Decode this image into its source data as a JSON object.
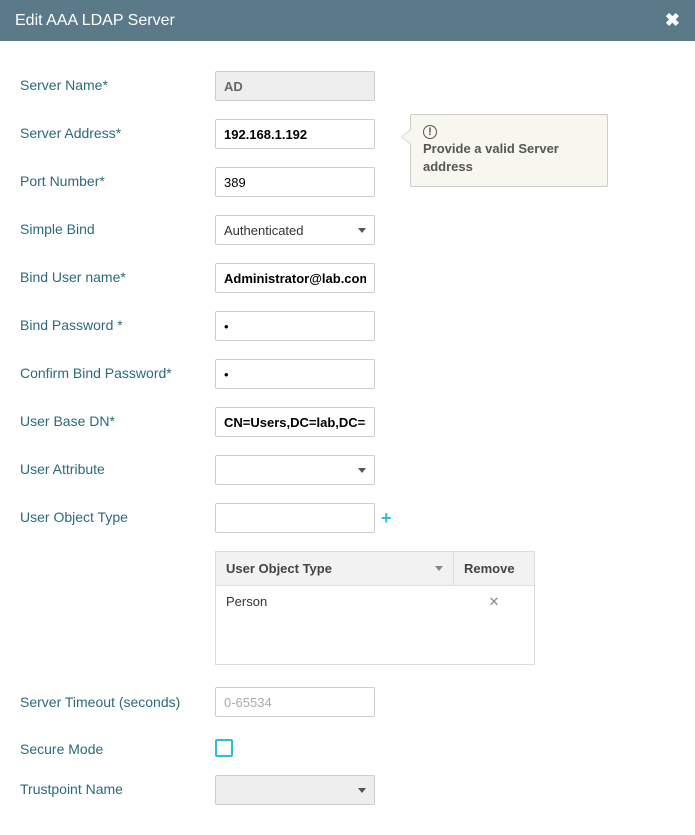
{
  "header": {
    "title": "Edit AAA LDAP Server"
  },
  "fields": {
    "serverName": {
      "label": "Server Name*",
      "value": "AD"
    },
    "serverAddress": {
      "label": "Server Address*",
      "value": "192.168.1.192"
    },
    "portNumber": {
      "label": "Port Number*",
      "value": "389"
    },
    "simpleBind": {
      "label": "Simple Bind",
      "value": "Authenticated"
    },
    "bindUser": {
      "label": "Bind User name*",
      "value": "Administrator@lab.com"
    },
    "bindPassword": {
      "label": "Bind Password *",
      "value": "•"
    },
    "confirmPassword": {
      "label": "Confirm Bind Password*",
      "value": "•"
    },
    "userBaseDN": {
      "label": "User Base DN*",
      "value": "CN=Users,DC=lab,DC=com"
    },
    "userAttribute": {
      "label": "User Attribute",
      "value": ""
    },
    "userObjectType": {
      "label": "User Object Type",
      "value": ""
    },
    "serverTimeout": {
      "label": "Server Timeout (seconds)",
      "placeholder": "0-65534",
      "value": ""
    },
    "secureMode": {
      "label": "Secure Mode",
      "checked": false
    },
    "trustpoint": {
      "label": "Trustpoint Name",
      "value": ""
    }
  },
  "callout": {
    "text": "Provide a valid Server address"
  },
  "table": {
    "headers": {
      "col1": "User Object Type",
      "col2": "Remove"
    },
    "rows": [
      {
        "type": "Person"
      }
    ]
  }
}
